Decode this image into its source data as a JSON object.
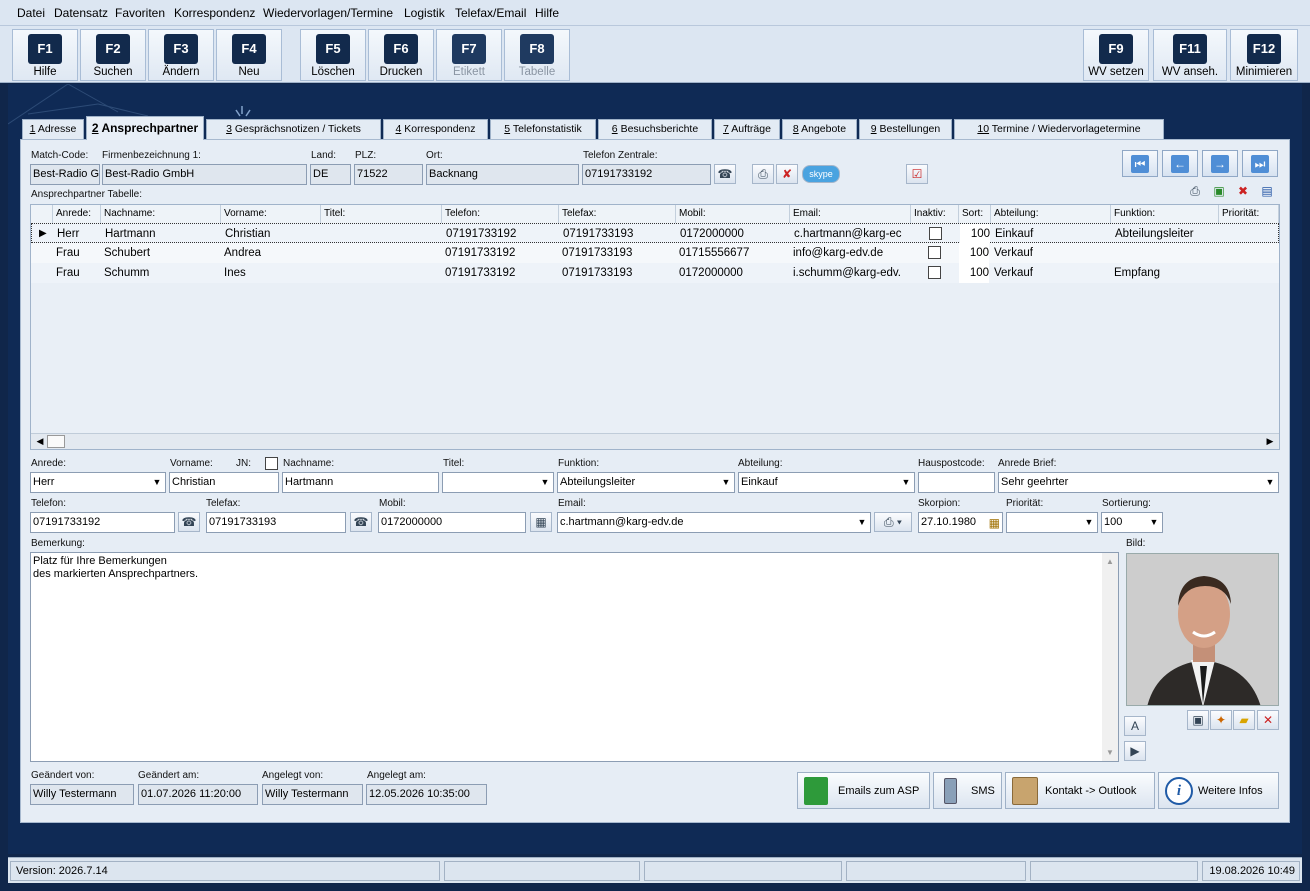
{
  "menu": [
    "Datei",
    "Datensatz",
    "Favoriten",
    "Korrespondenz",
    "Wiedervorlagen/Termine",
    "Logistik",
    "Telefax/Email",
    "Hilfe"
  ],
  "fkeys": [
    {
      "key": "F1",
      "label": "Hilfe"
    },
    {
      "key": "F2",
      "label": "Suchen"
    },
    {
      "key": "F3",
      "label": "Ändern"
    },
    {
      "key": "F4",
      "label": "Neu"
    },
    {
      "key": "F5",
      "label": "Löschen"
    },
    {
      "key": "F6",
      "label": "Drucken"
    },
    {
      "key": "F7",
      "label": "Etikett"
    },
    {
      "key": "F8",
      "label": "Tabelle"
    },
    {
      "key": "F9",
      "label": "WV setzen"
    },
    {
      "key": "F11",
      "label": "WV anseh."
    },
    {
      "key": "F12",
      "label": "Minimieren"
    }
  ],
  "tabs": [
    {
      "n": "1",
      "t": "Adresse"
    },
    {
      "n": "2",
      "t": "Ansprechpartner"
    },
    {
      "n": "3",
      "t": "Gesprächsnotizen / Tickets"
    },
    {
      "n": "4",
      "t": "Korrespondenz"
    },
    {
      "n": "5",
      "t": "Telefonstatistik"
    },
    {
      "n": "6",
      "t": "Besuchsberichte"
    },
    {
      "n": "7",
      "t": "Aufträge"
    },
    {
      "n": "8",
      "t": "Angebote"
    },
    {
      "n": "9",
      "t": "Bestellungen"
    },
    {
      "n": "10",
      "t": "Termine / Wiedervorlagetermine"
    }
  ],
  "company": {
    "labels": {
      "match": "Match-Code:",
      "firma": "Firmenbezeichnung 1:",
      "land": "Land:",
      "plz": "PLZ:",
      "ort": "Ort:",
      "tel": "Telefon Zentrale:"
    },
    "match": "Best-Radio Gr",
    "firma": "Best-Radio GmbH",
    "land": "DE",
    "plz": "71522",
    "ort": "Backnang",
    "tel": "07191733192",
    "skype": "skype"
  },
  "grid": {
    "title": "Ansprechpartner Tabelle:",
    "headers": [
      "Anrede:",
      "Nachname:",
      "Vorname:",
      "Titel:",
      "Telefon:",
      "Telefax:",
      "Mobil:",
      "Email:",
      "Inaktiv:",
      "Sort:",
      "Abteilung:",
      "Funktion:",
      "Priorität:"
    ],
    "rows": [
      [
        "Herr",
        "Hartmann",
        "Christian",
        "",
        "07191733192",
        "07191733193",
        "0172000000",
        "c.hartmann@karg-ec",
        "",
        "100",
        "Einkauf",
        "Abteilungsleiter",
        ""
      ],
      [
        "Frau",
        "Schubert",
        "Andrea",
        "",
        "07191733192",
        "07191733193",
        "01715556677",
        "info@karg-edv.de",
        "",
        "100",
        "Verkauf",
        "",
        ""
      ],
      [
        "Frau",
        "Schumm",
        "Ines",
        "",
        "07191733192",
        "07191733193",
        "0172000000",
        "i.schumm@karg-edv.",
        "",
        "100",
        "Verkauf",
        "Empfang",
        ""
      ]
    ]
  },
  "detail": {
    "labels": {
      "anrede": "Anrede:",
      "vorname": "Vorname:",
      "jn": "JN:",
      "nachname": "Nachname:",
      "titel": "Titel:",
      "funktion": "Funktion:",
      "abteilung": "Abteilung:",
      "hauspost": "Hauspostcode:",
      "anredebrief": "Anrede Brief:",
      "telefon": "Telefon:",
      "telefax": "Telefax:",
      "mobil": "Mobil:",
      "email": "Email:",
      "skorpion": "Skorpion:",
      "prioritaet": "Priorität:",
      "sortierung": "Sortierung:",
      "bemerkung": "Bemerkung:",
      "bild": "Bild:"
    },
    "anrede": "Herr",
    "vorname": "Christian",
    "nachname": "Hartmann",
    "titel": "",
    "funktion": "Abteilungsleiter",
    "abteilung": "Einkauf",
    "hauspost": "",
    "anredebrief": "Sehr geehrter",
    "telefon": "07191733192",
    "telefax": "07191733193",
    "mobil": "0172000000",
    "email": "c.hartmann@karg-edv.de",
    "skorpion": "27.10.1980",
    "prioritaet": "",
    "sortierung": "100",
    "bemerkung1": "Platz für Ihre Bemerkungen",
    "bemerkung2": "des markierten Ansprechpartners."
  },
  "audit": {
    "labels": {
      "geaendert_von": "Geändert von:",
      "geaendert_am": "Geändert am:",
      "angelegt_von": "Angelegt von:",
      "angelegt_am": "Angelegt am:"
    },
    "geaendert_von": "Willy Testermann",
    "geaendert_am": "01.07.2026 11:20:00",
    "angelegt_von": "Willy Testermann",
    "angelegt_am": "12.05.2026 10:35:00"
  },
  "buttons": {
    "emails": "Emails zum ASP",
    "sms": "SMS",
    "outlook": "Kontakt -> Outlook",
    "infos": "Weitere Infos"
  },
  "status": {
    "version": "Version: 2026.7.14",
    "datetime": "19.08.2026 10:49"
  }
}
